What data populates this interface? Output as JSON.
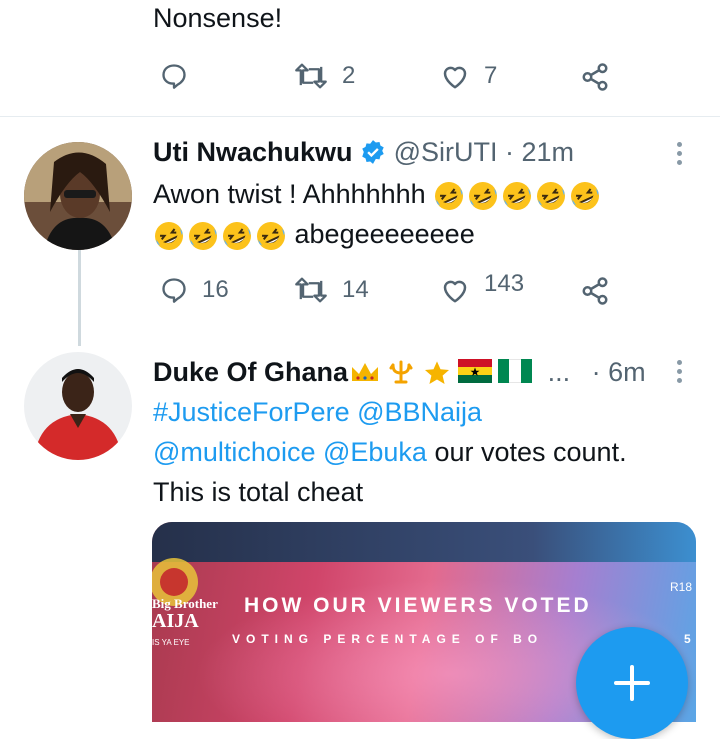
{
  "tweet_prev": {
    "text": "Nonsense!",
    "retweets": "2",
    "likes": "7"
  },
  "tweet1": {
    "name": "Uti Nwachukwu",
    "handle": "@SirUTI",
    "separator": "·",
    "time": "21m",
    "line1": "Awon twist ! Ahhhhhhh",
    "line2_suffix": "abegeeeeeeee",
    "replies": "16",
    "retweets": "14",
    "likes": "143",
    "emoji": "rolling-on-floor-laughing"
  },
  "tweet2": {
    "name": "Duke Of Ghana",
    "ellipsis": "...",
    "separator": "·",
    "time": "6m",
    "hashtag": "#JusticeForPere",
    "mention1": "@BBNaija",
    "mention2": "@multichoice",
    "mention3": "@Ebuka",
    "rest1": "our votes count.",
    "line3": "This is total cheat",
    "name_emojis": [
      "crown",
      "trident",
      "star",
      "flag-ghana",
      "flag-nigeria"
    ]
  },
  "media": {
    "logo_line1": "Big Brother",
    "logo_line2": "AIJA",
    "logo_line3": "IS YA EYE",
    "headline": "HOW OUR VIEWERS VOTED",
    "subheadline": "VOTING PERCENTAGE OF BO",
    "sub_suffix": "5",
    "badge": "R18"
  },
  "fab": {
    "icon": "plus-icon"
  },
  "colors": {
    "accent": "#1d9bf0",
    "muted": "#536471",
    "divider": "#e6ecf0"
  }
}
